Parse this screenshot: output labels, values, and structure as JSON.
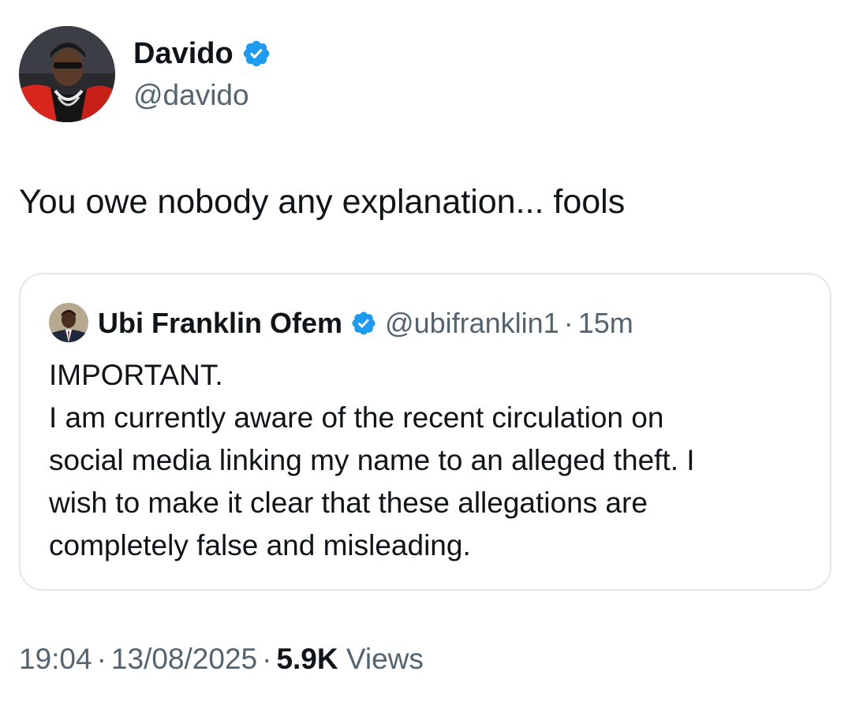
{
  "tweet": {
    "author": {
      "name": "Davido",
      "handle": "@davido",
      "verified": true
    },
    "text": "You owe nobody any explanation... fools",
    "quoted": {
      "author": {
        "name": "Ubi Franklin Ofem",
        "handle": "@ubifranklin1",
        "verified": true
      },
      "separator": "·",
      "time": "15m",
      "lines": [
        "IMPORTANT.",
        "I am currently aware of the recent circulation on",
        "social media linking my name to an alleged theft. I",
        "wish to make it clear that these allegations are",
        "completely false and misleading."
      ]
    },
    "meta": {
      "time": "19:04",
      "separator": "·",
      "date": "13/08/2025",
      "views_count": "5.9K",
      "views_label": "Views"
    }
  },
  "colors": {
    "verified_badge": "#1d9bf0",
    "text_primary": "#0f1419",
    "text_secondary": "#536471",
    "border": "#e1e8ed"
  },
  "icons": {
    "verified": "verified-badge-icon"
  }
}
